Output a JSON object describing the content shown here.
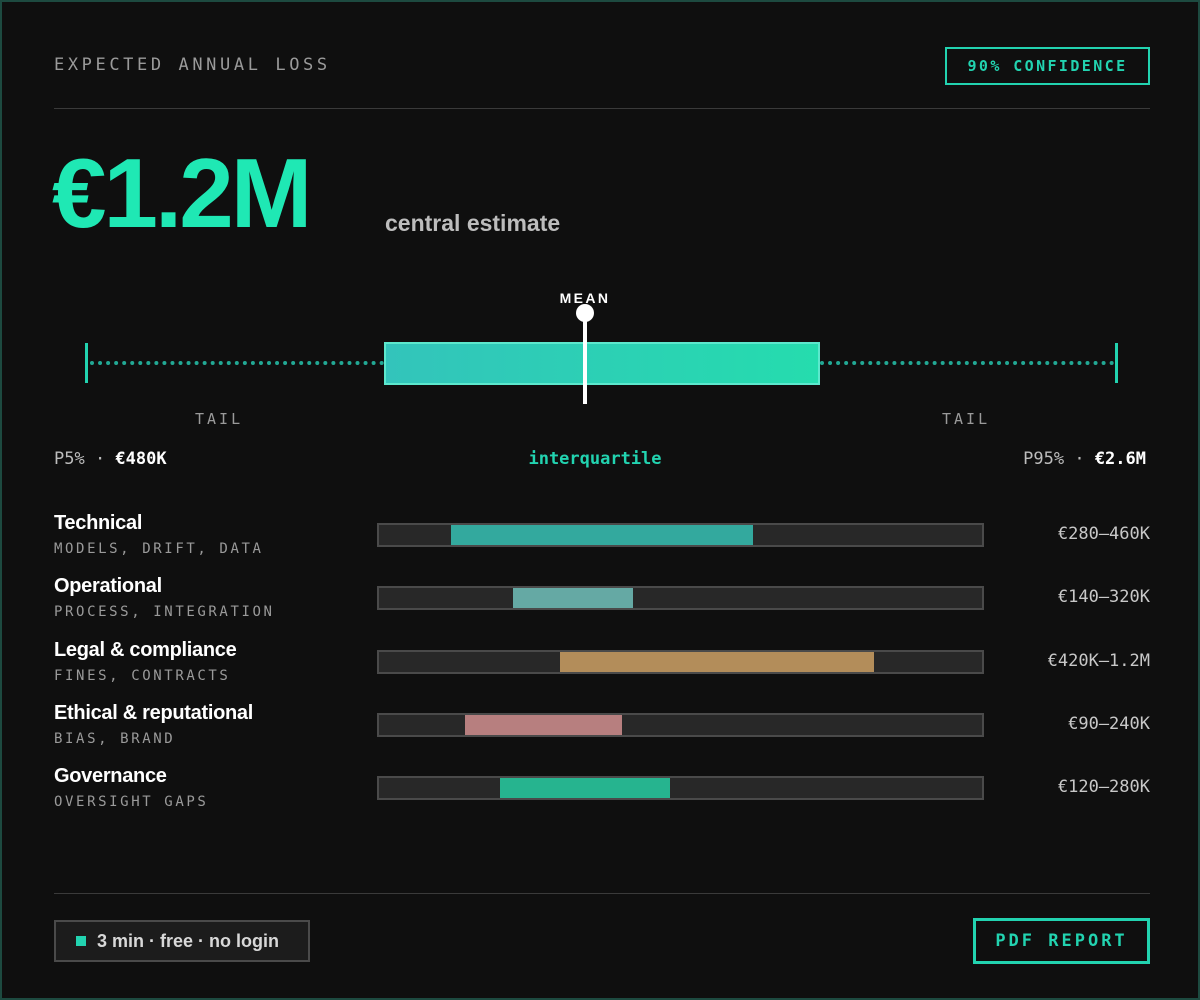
{
  "header": {
    "title": "EXPECTED ANNUAL LOSS",
    "badge": "90% CONFIDENCE"
  },
  "headline": {
    "value": "€1.2M",
    "label": "central estimate"
  },
  "distribution": {
    "mean_label": "MEAN",
    "tail_left": "TAIL",
    "tail_right": "TAIL",
    "p5_label": "P5% · ",
    "p5_value": "€480K",
    "iqr_label": "interquartile",
    "p95_label": "P95% · ",
    "p95_value": "€2.6M"
  },
  "categories": [
    {
      "name": "Technical",
      "sub": "MODELS, DRIFT, DATA",
      "range": "€280–460K",
      "fill_start": 0.12,
      "fill_end": 0.62,
      "color": "#33a99e"
    },
    {
      "name": "Operational",
      "sub": "PROCESS, INTEGRATION",
      "range": "€140–320K",
      "fill_start": 0.223,
      "fill_end": 0.422,
      "color": "#65a9a4"
    },
    {
      "name": "Legal & compliance",
      "sub": "FINES, CONTRACTS",
      "range": "€420K–1.2M",
      "fill_start": 0.3,
      "fill_end": 0.82,
      "color": "#b38d5a"
    },
    {
      "name": "Ethical & reputational",
      "sub": "BIAS, BRAND",
      "range": "€90–240K",
      "fill_start": 0.142,
      "fill_end": 0.402,
      "color": "#b77f7f"
    },
    {
      "name": "Governance",
      "sub": "OVERSIGHT GAPS",
      "range": "€120–280K",
      "fill_start": 0.2,
      "fill_end": 0.482,
      "color": "#26b48f"
    }
  ],
  "footer": {
    "badge": "3 min · free · no login",
    "button": "PDF REPORT"
  },
  "colors": {
    "accent": "#22d3b0",
    "headline": "#1fe8b4",
    "background": "#0f0f0f"
  }
}
